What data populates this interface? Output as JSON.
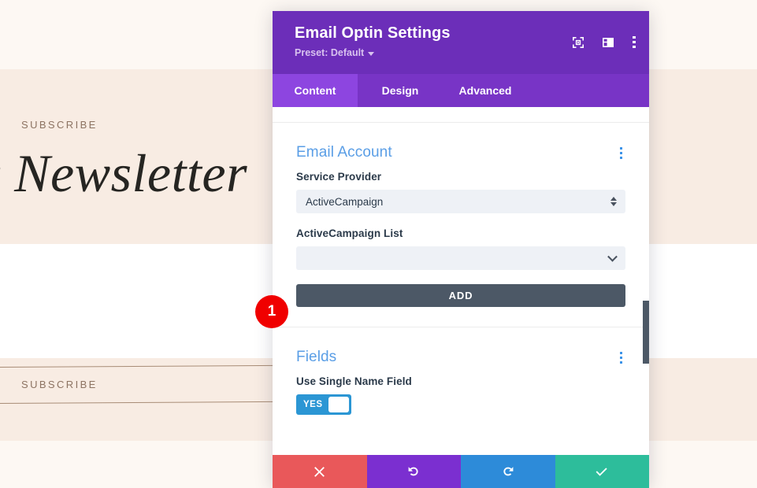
{
  "background": {
    "eyebrow_top": "SUBSCRIBE",
    "headline": "y Newsletter",
    "eyebrow_bottom": "SUBSCRIBE"
  },
  "modal": {
    "title": "Email Optin Settings",
    "preset": "Preset: Default",
    "header_icons": [
      {
        "name": "focus-icon"
      },
      {
        "name": "layout-panel-icon"
      },
      {
        "name": "more-vertical-icon"
      }
    ],
    "tabs": [
      {
        "label": "Content",
        "active": true
      },
      {
        "label": "Design",
        "active": false
      },
      {
        "label": "Advanced",
        "active": false
      }
    ],
    "sections": [
      {
        "title": "Email Account",
        "service_provider_label": "Service Provider",
        "service_provider_value": "ActiveCampaign",
        "list_label": "ActiveCampaign List",
        "list_value": "",
        "add_button": "ADD"
      },
      {
        "title": "Fields",
        "single_name_label": "Use Single Name Field",
        "single_name_toggle": "YES"
      }
    ],
    "footer": [
      {
        "name": "cancel-button",
        "glyph": "✖",
        "color": "#e9585a"
      },
      {
        "name": "undo-button",
        "glyph": "↺",
        "color": "#7b2fd0"
      },
      {
        "name": "redo-button",
        "glyph": "↻",
        "color": "#2d8bd9"
      },
      {
        "name": "save-button",
        "glyph": "✔",
        "color": "#2dbd9b"
      }
    ]
  },
  "annotation": {
    "step_number": "1"
  },
  "colors": {
    "header_purple": "#6c2eb9",
    "tab_bar_purple": "#7834c6",
    "tab_active_purple": "#8d45e0",
    "section_title_blue": "#5a9ee6",
    "add_button_slate": "#4c5866",
    "toggle_blue": "#2b96d4",
    "badge_red": "#f00000"
  }
}
